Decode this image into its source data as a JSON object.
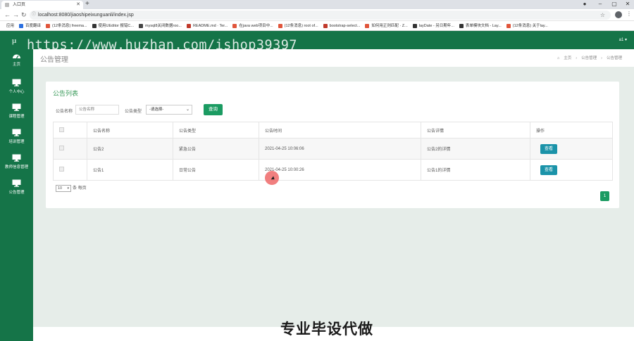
{
  "browser": {
    "tab_title": "入口页",
    "url": "localhost:8080/jiaoshipeixunguanli/index.jsp",
    "bookmarks": [
      {
        "label": "应用",
        "color": "#1a73e8"
      },
      {
        "label": "百度翻译",
        "color": "#2a6fe0"
      },
      {
        "label": "(12条消息) freema...",
        "color": "#e0553b"
      },
      {
        "label": "使用UEditor 报错C...",
        "color": "#333333"
      },
      {
        "label": "mysql8关闭数据roo...",
        "color": "#444444"
      },
      {
        "label": "README.md · Ter...",
        "color": "#c0392b"
      },
      {
        "label": "在java web项目中...",
        "color": "#e0553b"
      },
      {
        "label": "(12条消息) root of...",
        "color": "#e0553b"
      },
      {
        "label": "bootstrap-select...",
        "color": "#c0392b"
      },
      {
        "label": "如何用正则匹配 · Z...",
        "color": "#e0553b"
      },
      {
        "label": "layDate - 另日期年...",
        "color": "#333333"
      },
      {
        "label": "表单模块文档 - Lay...",
        "color": "#333333"
      },
      {
        "label": "(12条消息) 关于lay...",
        "color": "#e0553b"
      }
    ]
  },
  "app": {
    "logo": "μ",
    "user_menu": "a1 ▾",
    "nav": [
      {
        "label": "主页",
        "icon": "dashboard-icon"
      },
      {
        "label": "个人中心",
        "icon": "monitor-icon"
      },
      {
        "label": "课程管理",
        "icon": "monitor-icon"
      },
      {
        "label": "培训管理",
        "icon": "monitor-icon"
      },
      {
        "label": "教师信息管理",
        "icon": "monitor-icon"
      },
      {
        "label": "公告管理",
        "icon": "monitor-icon"
      }
    ]
  },
  "page": {
    "title": "公告管理",
    "breadcrumbs": [
      "主页",
      "公告管理",
      "公告管理"
    ],
    "card_title": "公告列表",
    "filters": {
      "name_label": "公告名称",
      "name_placeholder": "公告名称",
      "type_label": "公告类型",
      "type_selected": "-请选择-",
      "query_button": "查询"
    },
    "table": {
      "headers": [
        "",
        "公告名称",
        "公告类型",
        "公告时间",
        "公告详情",
        "操作"
      ],
      "rows": [
        {
          "name": "公告2",
          "type": "紧急公告",
          "time": "2021-04-25 10:06:06",
          "detail": "公告2的详情",
          "action": "查看"
        },
        {
          "name": "公告1",
          "type": "日常公告",
          "time": "2021-04-25 10:00:26",
          "detail": "公告1的详情",
          "action": "查看"
        }
      ]
    },
    "pager": {
      "page_size": "10",
      "page_size_suffix": "条 每页",
      "current_page": "1"
    }
  },
  "overlay": {
    "watermark": "https://www.huzhan.com/ishop39397",
    "caption": "专业毕设代做"
  }
}
